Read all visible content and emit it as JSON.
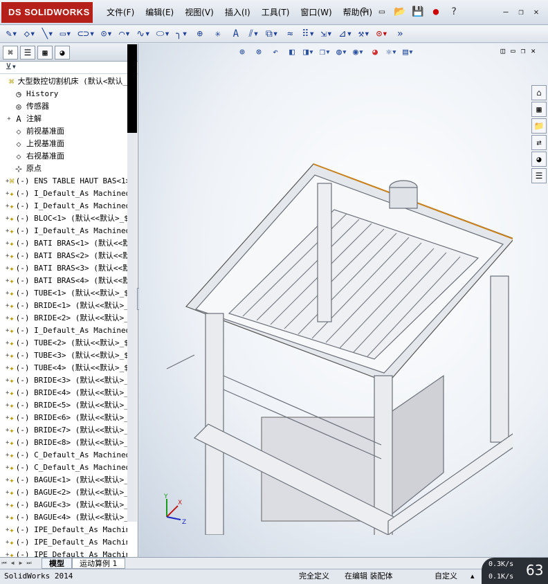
{
  "app": {
    "brand": "SOLIDWORKS",
    "logo_prefix": "DS"
  },
  "menu": [
    "文件(F)",
    "编辑(E)",
    "视图(V)",
    "插入(I)",
    "工具(T)",
    "窗口(W)",
    "帮助(H)"
  ],
  "quick_icons": [
    "pin-icon",
    "new-doc-icon",
    "open-folder-icon",
    "save-icon",
    "traffic-light-icon"
  ],
  "help": "?",
  "window_buttons": [
    "minimize",
    "restore",
    "close"
  ],
  "tools": [
    "sketch",
    "smart-dimension",
    "line",
    "rectangle",
    "slot",
    "circle",
    "arc",
    "spline",
    "ellipse",
    "fillet",
    "point",
    "construction",
    "text",
    "mirror",
    "offset",
    "trim",
    "convert",
    "linear-pattern",
    "move",
    "display",
    "repair",
    "quick-snaps"
  ],
  "panel_tabs": [
    "featuremanager",
    "propertymanager",
    "configurationmanager",
    "displaymanager"
  ],
  "tree": [
    {
      "label": "大型数控切割机床  (默认<默认_",
      "icon": "assembly",
      "level": 0,
      "expand": ""
    },
    {
      "label": "History",
      "icon": "history",
      "level": 1,
      "expand": ""
    },
    {
      "label": "传感器",
      "icon": "sensor",
      "level": 1,
      "expand": ""
    },
    {
      "label": "注解",
      "icon": "annotation",
      "level": 1,
      "expand": "+"
    },
    {
      "label": "前视基准面",
      "icon": "plane",
      "level": 1,
      "expand": ""
    },
    {
      "label": "上视基准面",
      "icon": "plane",
      "level": 1,
      "expand": ""
    },
    {
      "label": "右视基准面",
      "icon": "plane",
      "level": 1,
      "expand": ""
    },
    {
      "label": "原点",
      "icon": "origin",
      "level": 1,
      "expand": ""
    },
    {
      "label": "(-) ENS TABLE HAUT BAS<1>",
      "icon": "subassembly",
      "level": 1,
      "expand": "+"
    },
    {
      "label": "(-) I_Default_As Machined_",
      "icon": "part",
      "level": 1,
      "expand": "+"
    },
    {
      "label": "(-) I_Default_As Machined_",
      "icon": "part",
      "level": 1,
      "expand": "+"
    },
    {
      "label": "(-) BLOC<1> (默认<<默认>_$",
      "icon": "part",
      "level": 1,
      "expand": "+"
    },
    {
      "label": "(-) I_Default_As Machined_",
      "icon": "part",
      "level": 1,
      "expand": "+"
    },
    {
      "label": "(-) BATI BRAS<1> (默认<<默",
      "icon": "part",
      "level": 1,
      "expand": "+"
    },
    {
      "label": "(-) BATI BRAS<2> (默认<<默",
      "icon": "part",
      "level": 1,
      "expand": "+"
    },
    {
      "label": "(-) BATI BRAS<3> (默认<<默",
      "icon": "part",
      "level": 1,
      "expand": "+"
    },
    {
      "label": "(-) BATI BRAS<4> (默认<<默",
      "icon": "part",
      "level": 1,
      "expand": "+"
    },
    {
      "label": "(-) TUBE<1> (默认<<默认>_$",
      "icon": "part",
      "level": 1,
      "expand": "+"
    },
    {
      "label": "(-) BRIDE<1> (默认<<默认>_",
      "icon": "part",
      "level": 1,
      "expand": "+"
    },
    {
      "label": "(-) BRIDE<2> (默认<<默认>_",
      "icon": "part",
      "level": 1,
      "expand": "+"
    },
    {
      "label": "(-) I_Default_As Machined_",
      "icon": "part",
      "level": 1,
      "expand": "+"
    },
    {
      "label": "(-) TUBE<2> (默认<<默认>_$",
      "icon": "part",
      "level": 1,
      "expand": "+"
    },
    {
      "label": "(-) TUBE<3> (默认<<默认>_$",
      "icon": "part",
      "level": 1,
      "expand": "+"
    },
    {
      "label": "(-) TUBE<4> (默认<<默认>_$",
      "icon": "part",
      "level": 1,
      "expand": "+"
    },
    {
      "label": "(-) BRIDE<3> (默认<<默认>_",
      "icon": "part",
      "level": 1,
      "expand": "+"
    },
    {
      "label": "(-) BRIDE<4> (默认<<默认>_",
      "icon": "part",
      "level": 1,
      "expand": "+"
    },
    {
      "label": "(-) BRIDE<5> (默认<<默认>_",
      "icon": "part",
      "level": 1,
      "expand": "+"
    },
    {
      "label": "(-) BRIDE<6> (默认<<默认>_",
      "icon": "part",
      "level": 1,
      "expand": "+"
    },
    {
      "label": "(-) BRIDE<7> (默认<<默认>_",
      "icon": "part",
      "level": 1,
      "expand": "+"
    },
    {
      "label": "(-) BRIDE<8> (默认<<默认>_",
      "icon": "part",
      "level": 1,
      "expand": "+"
    },
    {
      "label": "(-) C_Default_As Machined_",
      "icon": "part",
      "level": 1,
      "expand": "+"
    },
    {
      "label": "(-) C_Default_As Machined_",
      "icon": "part",
      "level": 1,
      "expand": "+"
    },
    {
      "label": "(-) BAGUE<1> (默认<<默认>_",
      "icon": "part",
      "level": 1,
      "expand": "+"
    },
    {
      "label": "(-) BAGUE<2> (默认<<默认>_",
      "icon": "part",
      "level": 1,
      "expand": "+"
    },
    {
      "label": "(-) BAGUE<3> (默认<<默认>_",
      "icon": "part",
      "level": 1,
      "expand": "+"
    },
    {
      "label": "(-) BAGUE<4> (默认<<默认>_",
      "icon": "part",
      "level": 1,
      "expand": "+"
    },
    {
      "label": "(-) IPE_Default_As Machine",
      "icon": "part",
      "level": 1,
      "expand": "+"
    },
    {
      "label": "(-) IPE_Default_As Machine",
      "icon": "part",
      "level": 1,
      "expand": "+"
    },
    {
      "label": "(-) IPE_Default_As Machine",
      "icon": "part",
      "level": 1,
      "expand": "+"
    }
  ],
  "bottom_tabs": [
    "模型",
    "运动算例 1"
  ],
  "status": {
    "app": "SolidWorks 2014",
    "definition": "完全定义",
    "mode": "在编辑 装配体",
    "units": "自定义"
  },
  "net": {
    "up": "0.3K/s",
    "down": "0.1K/s",
    "value": "63"
  },
  "triad": {
    "x": "X",
    "y": "Y",
    "z": "Z"
  }
}
